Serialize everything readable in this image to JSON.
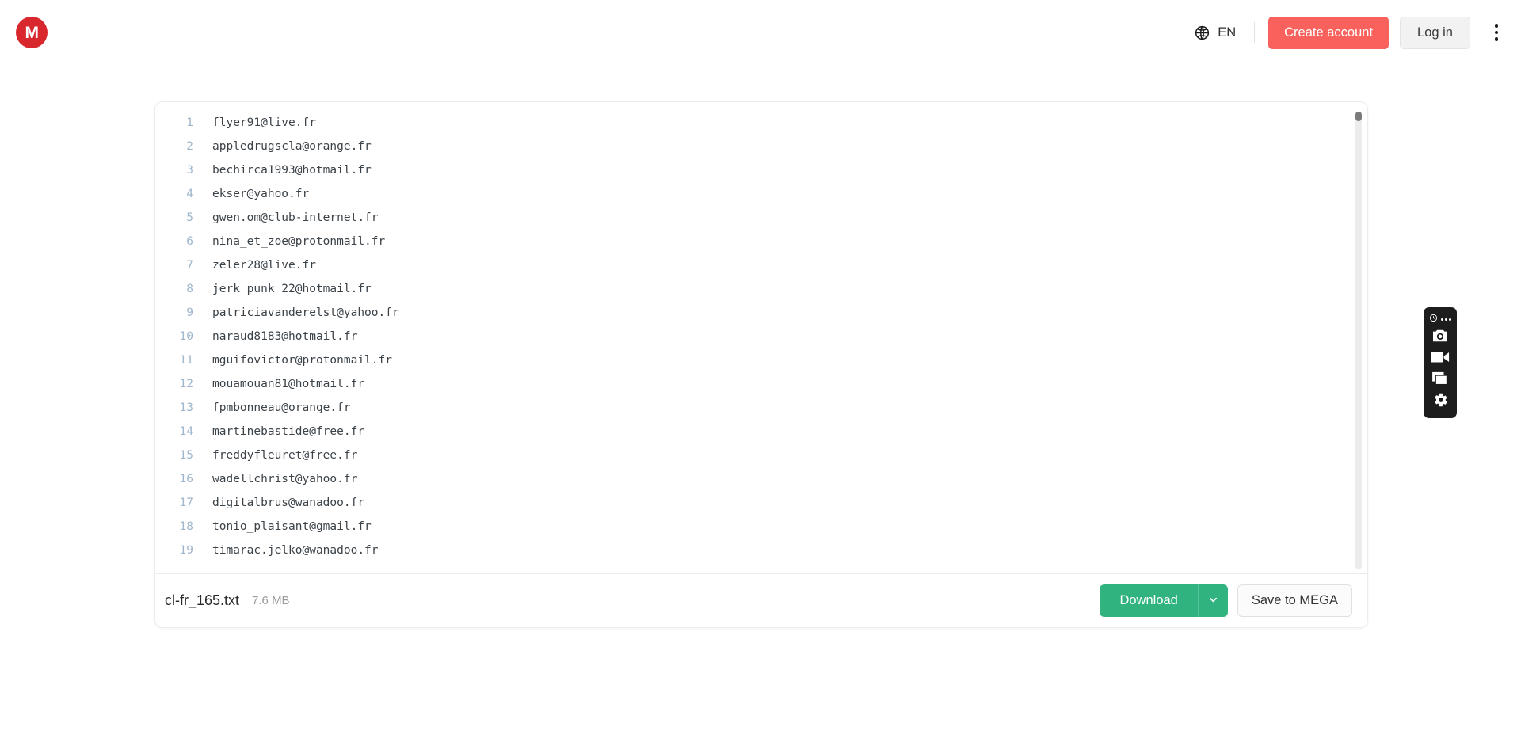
{
  "header": {
    "logo_letter": "M",
    "logo_color": "#d9272e",
    "language": "EN",
    "create_account_label": "Create account",
    "create_account_color": "#f9625c",
    "login_label": "Log in"
  },
  "viewer": {
    "lines": [
      {
        "n": "1",
        "text": "flyer91@live.fr"
      },
      {
        "n": "2",
        "text": "appledrugscla@orange.fr"
      },
      {
        "n": "3",
        "text": "bechirca1993@hotmail.fr"
      },
      {
        "n": "4",
        "text": "ekser@yahoo.fr"
      },
      {
        "n": "5",
        "text": "gwen.om@club-internet.fr"
      },
      {
        "n": "6",
        "text": "nina_et_zoe@protonmail.fr"
      },
      {
        "n": "7",
        "text": "zeler28@live.fr"
      },
      {
        "n": "8",
        "text": "jerk_punk_22@hotmail.fr"
      },
      {
        "n": "9",
        "text": "patriciavanderelst@yahoo.fr"
      },
      {
        "n": "10",
        "text": "naraud8183@hotmail.fr"
      },
      {
        "n": "11",
        "text": "mguifovictor@protonmail.fr"
      },
      {
        "n": "12",
        "text": "mouamouan81@hotmail.fr"
      },
      {
        "n": "13",
        "text": "fpmbonneau@orange.fr"
      },
      {
        "n": "14",
        "text": "martinebastide@free.fr"
      },
      {
        "n": "15",
        "text": "freddyfleuret@free.fr"
      },
      {
        "n": "16",
        "text": "wadellchrist@yahoo.fr"
      },
      {
        "n": "17",
        "text": "digitalbrus@wanadoo.fr"
      },
      {
        "n": "18",
        "text": "tonio_plaisant@gmail.fr"
      },
      {
        "n": "19",
        "text": "timarac.jelko@wanadoo.fr"
      }
    ]
  },
  "footer": {
    "file_name": "cl-fr_165.txt",
    "file_size": "7.6 MB",
    "download_label": "Download",
    "download_color": "#31b37f",
    "save_label": "Save to MEGA"
  },
  "float_toolbar": {
    "items": [
      "camera-icon",
      "video-camera-icon",
      "window-capture-icon",
      "gear-icon"
    ]
  }
}
